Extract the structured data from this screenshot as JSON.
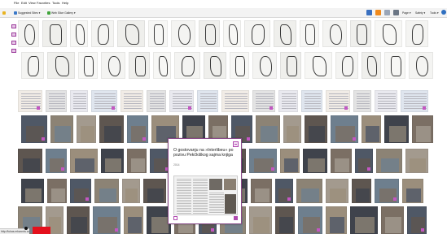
{
  "menu": {
    "items": [
      "File",
      "Edit",
      "View",
      "Favorites",
      "Tools",
      "Help"
    ]
  },
  "favorites_bar": {
    "items": [
      {
        "label": "Suggested Sites ▾",
        "icon": "suggested-sites-icon",
        "color": "#3a78c8"
      },
      {
        "label": "Web Slice Gallery ▾",
        "icon": "web-slice-icon",
        "color": "#3fa43a"
      }
    ]
  },
  "command_bar": {
    "icons": [
      {
        "name": "home-icon",
        "color": "#3a70c0"
      },
      {
        "name": "feeds-icon",
        "color": "#f08a1c"
      },
      {
        "name": "read-mail-icon",
        "color": "#9aa6b8"
      },
      {
        "name": "print-icon",
        "color": "#6b7685"
      }
    ],
    "menus": [
      "Page ▾",
      "Safety ▾",
      "Tools ▾"
    ],
    "help_icon": "help-icon"
  },
  "popup": {
    "title": "O gostovanju na »Interlibeu« po pozivu Pekčkiškog sajma knjiga",
    "date": "2014",
    "pin_icon": "pin-icon",
    "thumbnail_icon": "newspaper-clipping-icon"
  },
  "status_bar": {
    "text": "http://lukas.mkwords.com/..."
  },
  "colors": {
    "accent": "#8a4a8a",
    "badge": "#b04ab0",
    "red_block": "#e4101c"
  }
}
